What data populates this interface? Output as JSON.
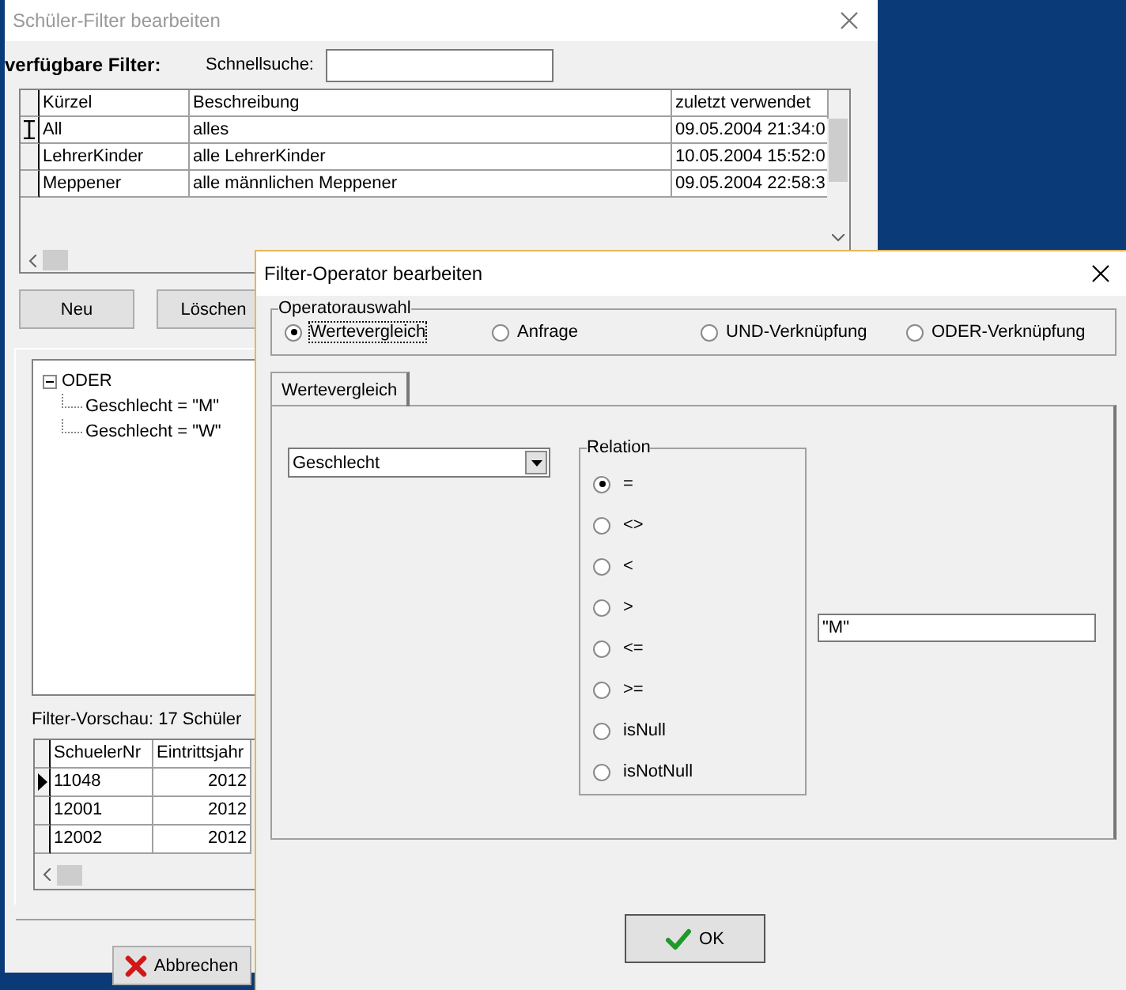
{
  "background_window": {
    "title": "Schüler-Filter bearbeiten",
    "filters_label": "verfügbare Filter:",
    "search_label": "Schnellsuche:",
    "filter_table": {
      "columns": [
        "Kürzel",
        "Beschreibung",
        "zuletzt verwendet"
      ],
      "rows": [
        {
          "editing": true,
          "cells": [
            "All",
            "alles",
            "09.05.2004 21:34:0"
          ]
        },
        {
          "editing": false,
          "cells": [
            "LehrerKinder",
            "alle LehrerKinder",
            "10.05.2004 15:52:0"
          ]
        },
        {
          "editing": false,
          "cells": [
            "Meppener",
            "alle männlichen Meppener",
            "09.05.2004 22:58:3"
          ]
        }
      ]
    },
    "buttons": [
      "Neu",
      "Löschen"
    ],
    "tree": [
      {
        "label": "ODER",
        "expanded": true,
        "children": [
          {
            "label": "Geschlecht = \"M\""
          },
          {
            "label": "Geschlecht = \"W\""
          }
        ]
      }
    ],
    "preview_label": "Filter-Vorschau:  17 Schüler",
    "preview_table": {
      "columns": [
        "SchuelerNr",
        "Eintrittsjahr"
      ],
      "rows": [
        {
          "current": true,
          "cells": [
            "11048",
            "2012"
          ]
        },
        {
          "current": false,
          "cells": [
            "12001",
            "2012"
          ]
        },
        {
          "current": false,
          "cells": [
            "12002",
            "2012"
          ]
        }
      ]
    },
    "cancel_button": "Abbrechen"
  },
  "dialog": {
    "title": "Filter-Operator bearbeiten",
    "operator_group": {
      "label": "Operatorauswahl",
      "options": [
        {
          "label": "Wertevergleich",
          "selected": true,
          "focused": true
        },
        {
          "label": "Anfrage",
          "selected": false,
          "focused": false
        },
        {
          "label": "UND-Verknüpfung",
          "selected": false,
          "focused": false
        },
        {
          "label": "ODER-Verknüpfung",
          "selected": false,
          "focused": false
        }
      ]
    },
    "tabs": [
      {
        "label": "Wertevergleich",
        "selected": true
      }
    ],
    "field_select": {
      "value": "Geschlecht"
    },
    "relation": {
      "label": "Relation",
      "options": [
        {
          "label": "=",
          "selected": true
        },
        {
          "label": "<>",
          "selected": false
        },
        {
          "label": "<",
          "selected": false
        },
        {
          "label": ">",
          "selected": false
        },
        {
          "label": "<=",
          "selected": false
        },
        {
          "label": ">=",
          "selected": false
        },
        {
          "label": "isNull",
          "selected": false
        },
        {
          "label": "isNotNull",
          "selected": false
        }
      ]
    },
    "value_field": {
      "value": "\"M\""
    },
    "ok_button": "OK"
  }
}
